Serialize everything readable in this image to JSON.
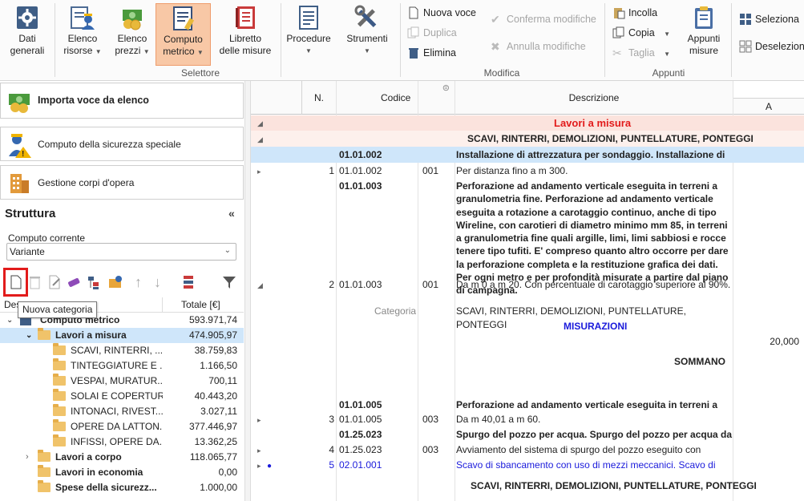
{
  "ribbon": {
    "buttons": [
      {
        "line1": "Dati",
        "line2": "generali"
      },
      {
        "line1": "Elenco",
        "line2": "risorse"
      },
      {
        "line1": "Elenco",
        "line2": "prezzi"
      },
      {
        "line1": "Computo",
        "line2": "metrico"
      },
      {
        "line1": "Libretto",
        "line2": "delle misure"
      },
      {
        "line1": "Procedure",
        "line2": ""
      },
      {
        "line1": "Strumenti",
        "line2": ""
      }
    ],
    "groups": {
      "selettore": "Selettore",
      "modifica": "Modifica",
      "appunti": "Appunti"
    },
    "modifica": {
      "nuova_voce": "Nuova voce",
      "duplica": "Duplica",
      "elimina": "Elimina",
      "conferma": "Conferma modifiche",
      "annulla": "Annulla modifiche"
    },
    "appunti": {
      "incolla": "Incolla",
      "copia": "Copia",
      "taglia": "Taglia",
      "appunti_line1": "Appunti",
      "appunti_line2": "misure"
    },
    "seleziona": "Seleziona",
    "deseleziona": "Deselezion"
  },
  "left": {
    "importa": "Importa voce da elenco",
    "sicurezza": "Computo della sicurezza speciale",
    "gestione": "Gestione corpi d'opera",
    "struttura": "Struttura",
    "collapse": "«",
    "computo_label": "Computo corrente",
    "computo_value": "Variante",
    "tooltip": "Nuova categoria",
    "col_desc": "Des",
    "col_tot": "Totale [€]",
    "tree": [
      {
        "name": "Computo metrico",
        "total": "593.971,74"
      },
      {
        "name": "Lavori a misura",
        "total": "474.905,97"
      },
      {
        "name": "SCAVI, RINTERRI, ...",
        "total": "38.759,83"
      },
      {
        "name": "TINTEGGIATURE E ...",
        "total": "1.166,50"
      },
      {
        "name": "VESPAI, MURATUR...",
        "total": "700,11"
      },
      {
        "name": "SOLAI E COPERTURE",
        "total": "40.443,20"
      },
      {
        "name": "INTONACI, RIVEST...",
        "total": "3.027,11"
      },
      {
        "name": "OPERE DA LATTON...",
        "total": "377.446,97"
      },
      {
        "name": "INFISSI, OPERE DA...",
        "total": "13.362,25"
      },
      {
        "name": "Lavori a corpo",
        "total": "118.065,77"
      },
      {
        "name": "Lavori in economia",
        "total": "0,00"
      },
      {
        "name": "Spese della sicurezz...",
        "total": "1.000,00"
      }
    ]
  },
  "grid": {
    "headers": {
      "n": "N.",
      "codice": "Codice",
      "descrizione": "Descrizione",
      "a": "A"
    },
    "section_title": "Lavori a misura",
    "category": "SCAVI, RINTERRI, DEMOLIZIONI, PUNTELLATURE, PONTEGGI",
    "r1": {
      "code": "01.01.002",
      "desc": "Installazione di attrezzatura per sondaggio. Installazione di"
    },
    "r2": {
      "n": "1",
      "code": "01.01.002",
      "sub": "001",
      "desc": "Per distanza fino a m 300."
    },
    "r3": {
      "code": "01.01.003",
      "desc": "Perforazione ad andamento verticale eseguita in terreni a granulometria fine. Perforazione ad andamento verticale eseguita a rotazione a carotaggio continuo, anche di tipo Wireline, con carotieri di diametro minimo mm 85, in terreni a granulometria fine quali argille, limi, limi sabbiosi e rocce tenere tipo tufiti. E' compreso quanto altro occorre per dare la perforazione completa e la restituzione grafica dei dati. Per ogni metro e per profondità misurate a partire dal piano di campagna."
    },
    "r4": {
      "n": "2",
      "code": "01.01.003",
      "sub": "001",
      "desc": "Da m 0 a m 20. Con percentuale di carotaggio superiore al 90%."
    },
    "r5": {
      "label": "Categoria",
      "desc": "SCAVI, RINTERRI, DEMOLIZIONI, PUNTELLATURE, PONTEGGI"
    },
    "misurazioni": "MISURAZIONI",
    "value_a": "20,000",
    "sommano": "SOMMANO",
    "r6": {
      "code": "01.01.005",
      "desc": "Perforazione ad andamento verticale eseguita in terreni a"
    },
    "r7": {
      "n": "3",
      "code": "01.01.005",
      "sub": "003",
      "desc": "Da m 40,01 a m 60."
    },
    "r8": {
      "code": "01.25.023",
      "desc": "Spurgo del pozzo per acqua. Spurgo del pozzo per acqua da"
    },
    "r9": {
      "n": "4",
      "code": "01.25.023",
      "sub": "003",
      "desc": "Avviamento del sistema di spurgo del pozzo eseguito con"
    },
    "r10": {
      "n": "5",
      "code": "02.01.001",
      "desc": "Scavo di sbancamento con uso di mezzi meccanici. Scavo di"
    },
    "r11": {
      "desc": "SCAVI, RINTERRI, DEMOLIZIONI, PUNTELLATURE, PONTEGGI"
    }
  },
  "colors": {
    "accent_red": "#e21b1b",
    "link_blue": "#1a1adb",
    "row_selected": "#cfe6fa",
    "section_band": "#fbe3dd"
  }
}
